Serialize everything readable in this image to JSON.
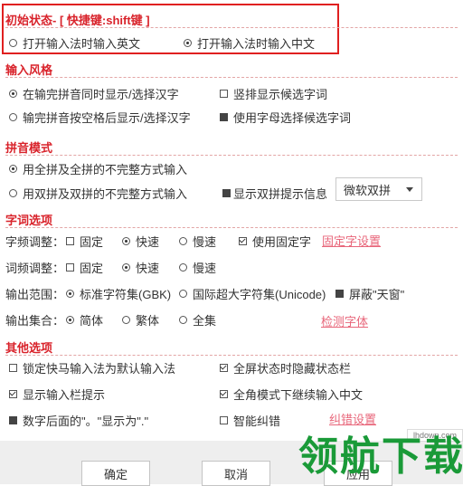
{
  "initial_state": {
    "title": "初始状态- [ 快捷键:shift键 ]",
    "options": [
      "打开输入法时输入英文",
      "打开输入法时输入中文"
    ],
    "selected": 1
  },
  "input_style": {
    "title": "输入风格",
    "radio1": "在输完拼音同时显示/选择汉字",
    "radio2": "输完拼音按空格后显示/选择汉字",
    "check_vertical": "竖排显示候选字词",
    "check_letters": "使用字母选择候选字词"
  },
  "pinyin_mode": {
    "title": "拼音模式",
    "radio1": "用全拼及全拼的不完整方式输入",
    "radio2": "用双拼及双拼的不完整方式输入",
    "check_hint": "显示双拼提示信息",
    "scheme_select": "微软双拼"
  },
  "word_options": {
    "title": "字词选项",
    "freq_label": "字频调整：",
    "freq_fixed": "固定",
    "freq_fast": "快速",
    "freq_slow": "慢速",
    "use_fixed_char": "使用固定字",
    "fixed_char_link": "固定字设置",
    "word_freq_label": "词频调整：",
    "word_fixed": "固定",
    "word_fast": "快速",
    "word_slow": "慢速",
    "range_label": "输出范围：",
    "range_gbk": "标准字符集(GBK)",
    "range_unicode": "国际超大字符集(Unicode)",
    "block_tianchuang": "屏蔽\"天窗\"",
    "set_label": "输出集合：",
    "set_simplified": "简体",
    "set_traditional": "繁体",
    "set_all": "全集",
    "detect_font_link": "检测字体"
  },
  "other_options": {
    "title": "其他选项",
    "lock_default": "锁定快马输入法为默认输入法",
    "fullscreen_hide": "全屏状态时隐藏状态栏",
    "show_tips": "显示输入栏提示",
    "fullwidth_continue": "全角模式下继续输入中文",
    "digit_period": "数字后面的\"。\"显示为\".\"",
    "smart_correct": "智能纠错",
    "correct_link": "纠错设置"
  },
  "buttons": {
    "ok": "确定",
    "cancel": "取消",
    "apply": "应用"
  },
  "watermark": {
    "logo": "领航下载",
    "url": "lhdown.com"
  },
  "colors": {
    "section_title": "#d9232b",
    "link": "#e8667a",
    "highlight_border": "#e02020",
    "watermark": "#1a9a38"
  }
}
